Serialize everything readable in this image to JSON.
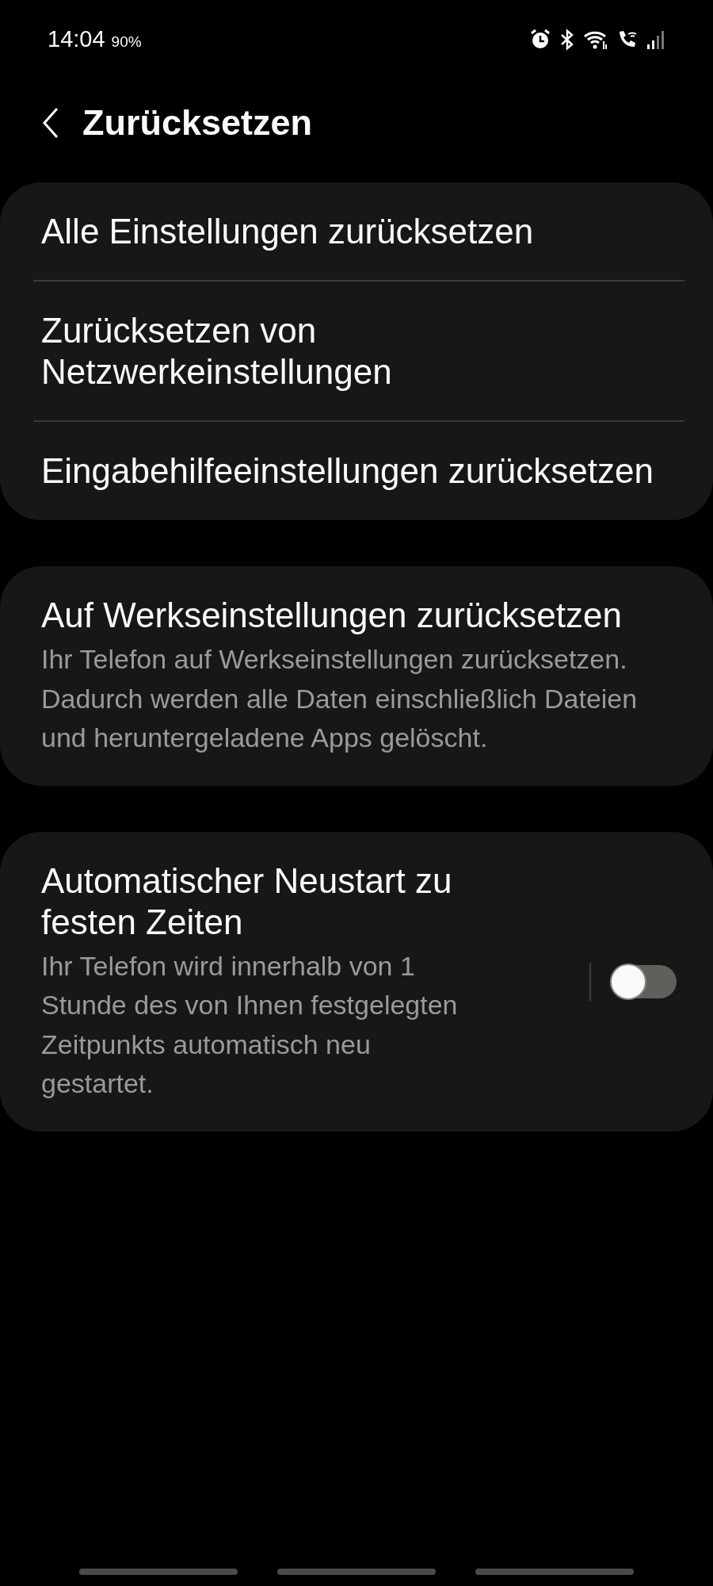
{
  "status_bar": {
    "time": "14:04",
    "battery": "90%"
  },
  "header": {
    "title": "Zurücksetzen"
  },
  "groups": [
    {
      "items": [
        {
          "kind": "action",
          "title": "Alle Einstellungen zurücksetzen"
        },
        {
          "kind": "action",
          "title": "Zurücksetzen von Netzwerkeinstellungen"
        },
        {
          "kind": "action",
          "title": "Eingabehilfeeinstellungen zurücksetzen"
        }
      ]
    },
    {
      "items": [
        {
          "kind": "action",
          "title": "Auf Werkseinstellungen zurücksetzen",
          "description": "Ihr Telefon auf Werkseinstellungen zurücksetzen. Dadurch werden alle Daten einschließlich Dateien und heruntergeladene Apps gelöscht."
        }
      ]
    },
    {
      "items": [
        {
          "kind": "toggle",
          "title": "Automatischer Neustart zu festen Zeiten",
          "description": "Ihr Telefon wird innerhalb von 1 Stunde des von Ihnen festgelegten Zeitpunkts automatisch neu gestartet.",
          "on": false
        }
      ]
    }
  ]
}
